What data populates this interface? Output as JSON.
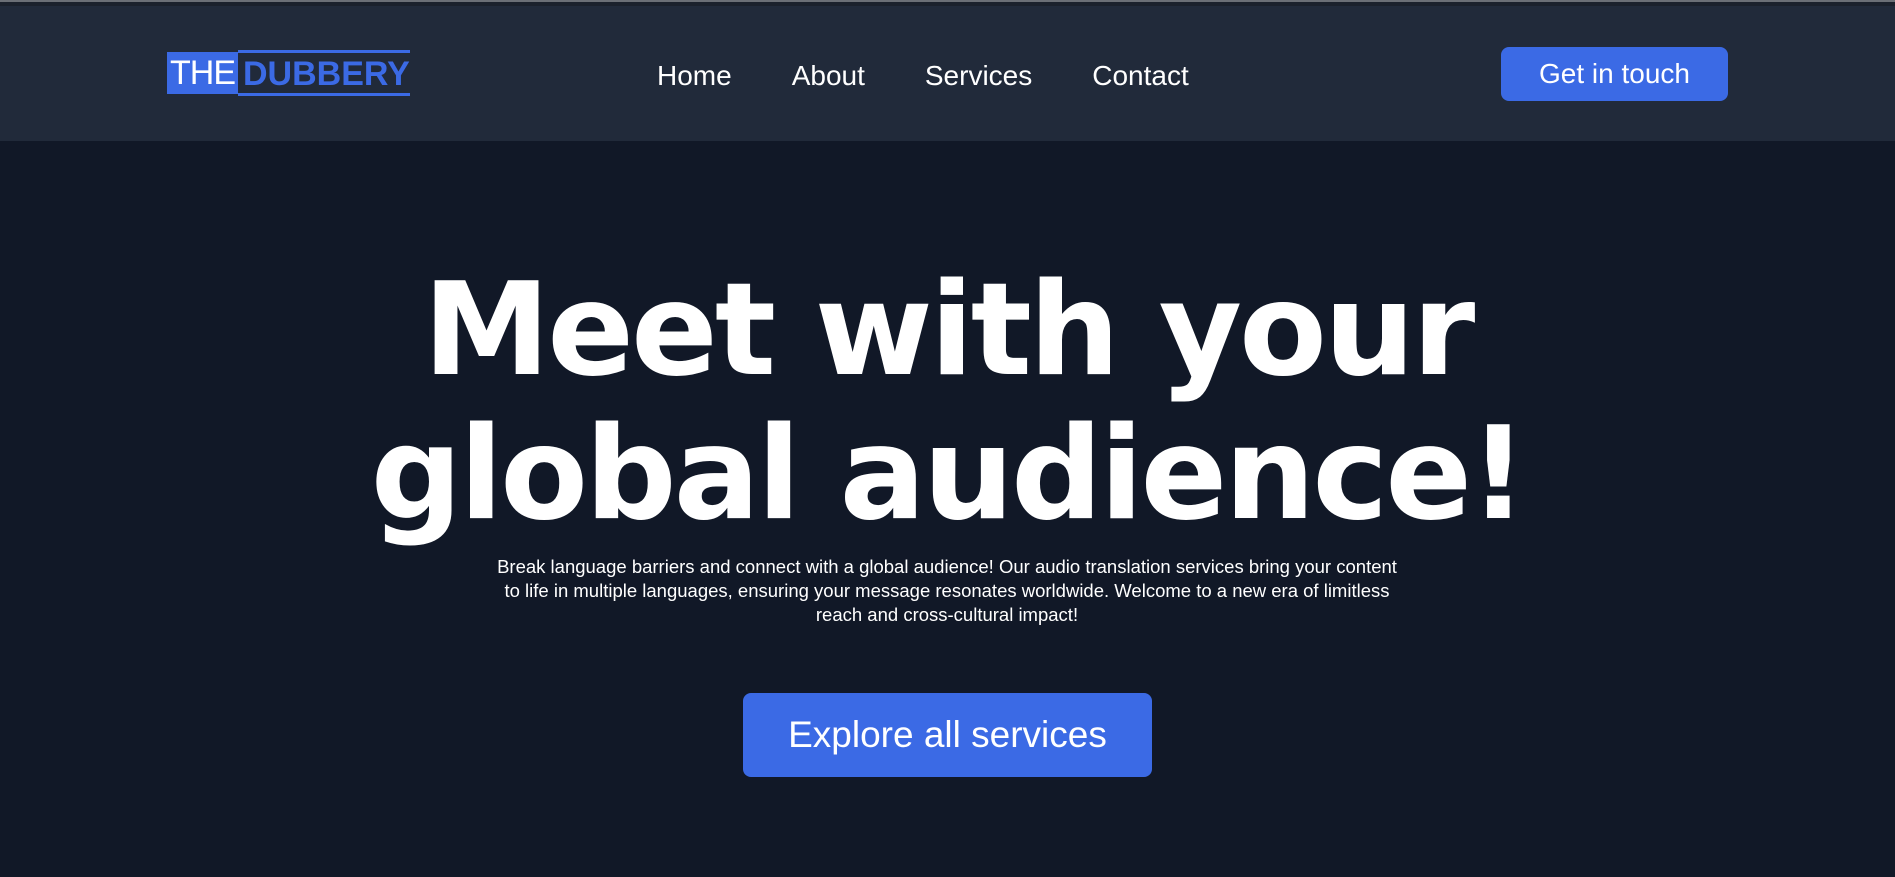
{
  "brand": {
    "logo_box_text": "THE",
    "logo_word_text": "DUBBERY",
    "accent_color": "#3b6ae5"
  },
  "nav": {
    "links": [
      "Home",
      "About",
      "Services",
      "Contact"
    ],
    "cta_label": "Get in touch"
  },
  "hero": {
    "headline_line1": "Meet with your",
    "headline_line2": "global audience!",
    "subtitle": "Break language barriers and connect with a global audience! Our audio translation services bring your content to life in multiple languages, ensuring your message resonates worldwide. Welcome to a new era of limitless reach and cross-cultural impact!",
    "cta_label": "Explore all services"
  },
  "colors": {
    "nav_bg": "#212a3a",
    "page_bg": "#111827",
    "text": "#ffffff"
  }
}
